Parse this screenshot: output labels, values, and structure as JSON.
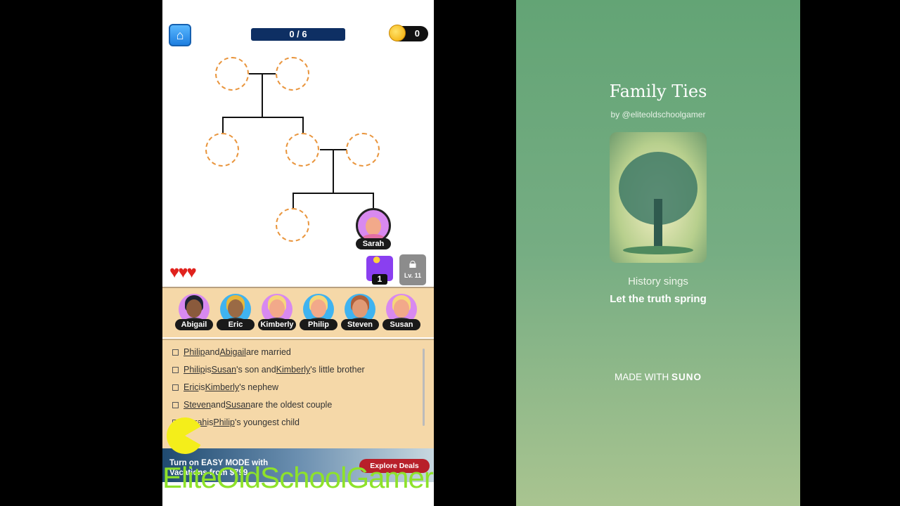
{
  "header": {
    "home_icon": "home-icon",
    "progress": "0 / 6",
    "progress_value": 0,
    "progress_max": 6,
    "coins": "0"
  },
  "tree": {
    "placed": {
      "name": "Sarah"
    }
  },
  "status": {
    "lives": 3,
    "hint_count": "1",
    "lock_label": "Lv. 11"
  },
  "characters": [
    {
      "name": "Abigail",
      "bg": "#d889f0",
      "hair": "#1b2233",
      "skin": "#8a5a3c"
    },
    {
      "name": "Eric",
      "bg": "#3fb3f0",
      "hair": "#e8b83a",
      "skin": "#9a6a45"
    },
    {
      "name": "Kimberly",
      "bg": "#d889f0",
      "hair": "#f6d77a",
      "skin": "#f2a98a"
    },
    {
      "name": "Philip",
      "bg": "#3fb3f0",
      "hair": "#f6d77a",
      "skin": "#f2a98a"
    },
    {
      "name": "Steven",
      "bg": "#3fb3f0",
      "hair": "#b0603a",
      "skin": "#e09a75"
    },
    {
      "name": "Susan",
      "bg": "#d889f0",
      "hair": "#f6d77a",
      "skin": "#f2a98a"
    }
  ],
  "clues": [
    [
      {
        "t": "Philip",
        "u": true
      },
      {
        "t": " and "
      },
      {
        "t": "Abigail",
        "u": true
      },
      {
        "t": " are married"
      }
    ],
    [
      {
        "t": "Philip",
        "u": true
      },
      {
        "t": " is "
      },
      {
        "t": "Susan",
        "u": true
      },
      {
        "t": "'s son and "
      },
      {
        "t": "Kimberly",
        "u": true
      },
      {
        "t": "'s little brother"
      }
    ],
    [
      {
        "t": "Eric",
        "u": true
      },
      {
        "t": " is "
      },
      {
        "t": "Kimberly",
        "u": true
      },
      {
        "t": "'s nephew"
      }
    ],
    [
      {
        "t": "Steven",
        "u": true
      },
      {
        "t": " and "
      },
      {
        "t": "Susan",
        "u": true
      },
      {
        "t": " are the oldest couple"
      }
    ],
    [
      {
        "t": "Sarah",
        "u": true
      },
      {
        "t": " is "
      },
      {
        "t": "Philip",
        "u": true
      },
      {
        "t": "'s youngest child"
      }
    ]
  ],
  "ad": {
    "line1": "Turn on EASY MODE with",
    "line2": "Vacations from $799",
    "button": "Explore Deals"
  },
  "watermark": "EliteOldSchoolGamer",
  "music": {
    "title": "Family Ties",
    "byline": "by @eliteoldschoolgamer",
    "lyric1": "History sings",
    "lyric2": "Let the truth spring",
    "made_with": "MADE WITH",
    "brand": "SUNO"
  }
}
